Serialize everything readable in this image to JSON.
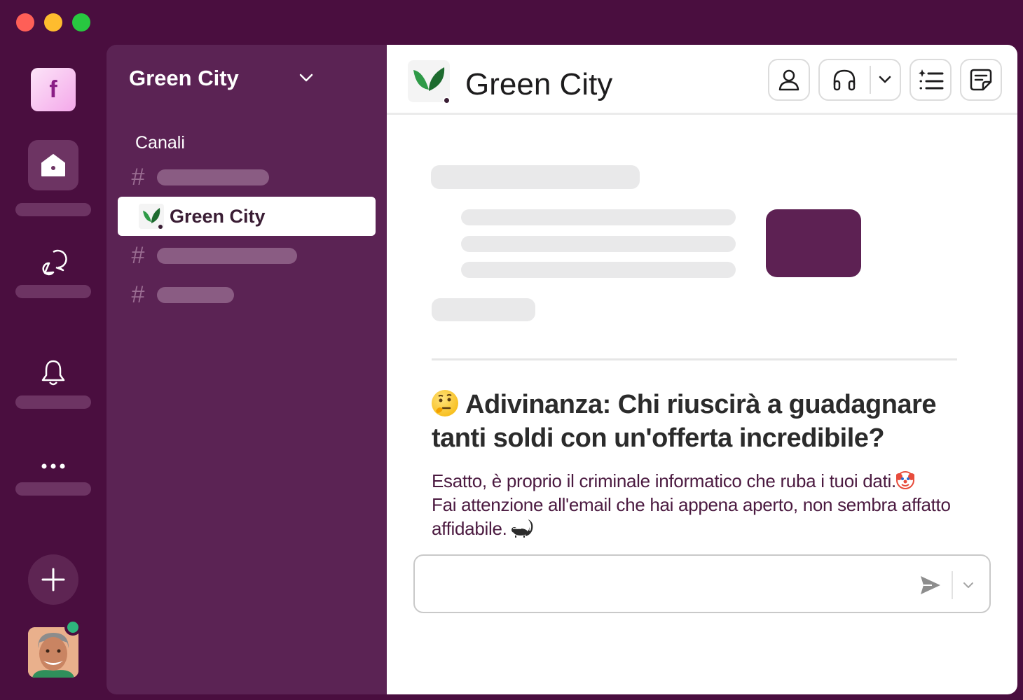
{
  "window": {
    "controls": [
      "close",
      "minimize",
      "maximize"
    ]
  },
  "rail": {
    "workspace_initial": "f",
    "items": [
      {
        "name": "home",
        "icon": "home-icon",
        "active": true
      },
      {
        "name": "dms",
        "icon": "chat-bubbles-icon",
        "active": false
      },
      {
        "name": "activity",
        "icon": "bell-icon",
        "active": false
      },
      {
        "name": "more",
        "icon": "more-icon",
        "active": false
      }
    ],
    "add_icon": "plus-icon",
    "user_status": "online"
  },
  "sidebar": {
    "workspace_name": "Green City",
    "section_label": "Canali",
    "channels": [
      {
        "type": "placeholder"
      },
      {
        "type": "active",
        "label": "Green City"
      },
      {
        "type": "placeholder"
      },
      {
        "type": "placeholder"
      }
    ]
  },
  "channel": {
    "title": "Green City",
    "buttons": [
      "user-icon",
      "headphones-icon",
      "chevron-down-icon",
      "sparkle-list-icon",
      "canvas-note-icon"
    ]
  },
  "message": {
    "title": "Adivinanza: Chi riuscirà a guadagnare tanti soldi con un'offerta incredibile?",
    "body_line1": "Esatto, è proprio il criminale informatico che ruba i tuoi dati.",
    "body_line2": "Fai attenzione all'email che hai appena aperto, non sembra affatto affidabile.",
    "emojis": [
      "thinking-face",
      "clown-face",
      "skunk"
    ]
  },
  "composer": {
    "placeholder": "",
    "send_icon": "send-icon"
  },
  "colors": {
    "aubergine": "#4a0e3f",
    "sidebar": "#5b2354",
    "accent_block": "#5d2153",
    "presence": "#2eb67d"
  }
}
